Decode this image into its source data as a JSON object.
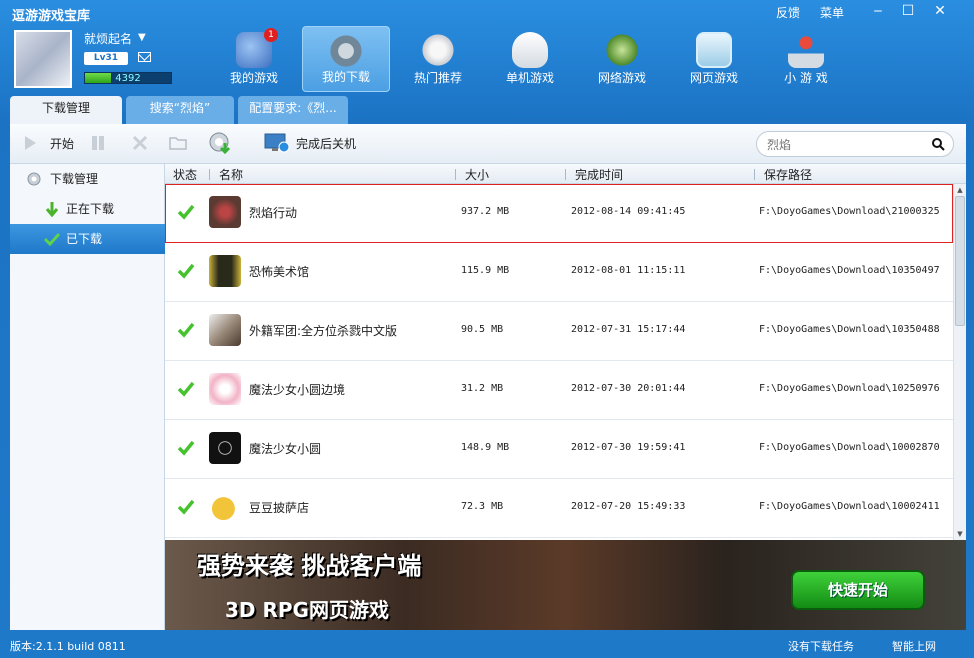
{
  "app": {
    "title": "逗游游戏宝库",
    "feedback": "反馈",
    "menu": "菜单",
    "minimize": "‒",
    "maximize": "☐",
    "close": "✕"
  },
  "user": {
    "name": "就烦起名",
    "level": "Lv31",
    "exp": "4392",
    "exp_fraction": 0.3
  },
  "nav": [
    {
      "label": "我的游戏",
      "badge": "1",
      "icon": "my-games-icon",
      "color": "#5f8fd6"
    },
    {
      "label": "我的下载",
      "icon": "download-gear-icon",
      "color": "#6f8799"
    },
    {
      "label": "热门推荐",
      "icon": "hot-recommend-icon",
      "color": "#d9a23c"
    },
    {
      "label": "单机游戏",
      "icon": "gamepad-icon",
      "color": "#e9eef4"
    },
    {
      "label": "网络游戏",
      "icon": "network-game-icon",
      "color": "#8bb34d"
    },
    {
      "label": "网页游戏",
      "icon": "web-game-icon",
      "color": "#a9d7ef"
    },
    {
      "label": "小 游 戏",
      "icon": "joystick-icon",
      "color": "#d63a2e"
    }
  ],
  "tabs": [
    {
      "label": "下载管理"
    },
    {
      "label": "搜索“烈焰”"
    },
    {
      "label": "配置要求:《烈..."
    }
  ],
  "toolbar": {
    "start": "开始",
    "shutdown_after": "完成后关机",
    "search_placeholder": "烈焰"
  },
  "sidebar": {
    "root": "下载管理",
    "downloading": "正在下载",
    "downloaded": "已下载"
  },
  "table": {
    "headers": {
      "status": "状态",
      "name": "名称",
      "size": "大小",
      "time": "完成时间",
      "path": "保存路径"
    },
    "rows": [
      {
        "name": "烈焰行动",
        "size": "937.2 MB",
        "time": "2012-08-14 09:41:45",
        "path": "F:\\DoyoGames\\Download\\21000325",
        "icon_color": "#5a3a32"
      },
      {
        "name": "恐怖美术馆",
        "size": "115.9 MB",
        "time": "2012-08-01 11:15:11",
        "path": "F:\\DoyoGames\\Download\\10350497",
        "icon_color": "#2a2a1a"
      },
      {
        "name": "外籍军团:全方位杀戮中文版",
        "size": "90.5 MB",
        "time": "2012-07-31 15:17:44",
        "path": "F:\\DoyoGames\\Download\\10350488",
        "icon_color": "#9a8a7a"
      },
      {
        "name": "魔法少女小圆边境",
        "size": "31.2 MB",
        "time": "2012-07-30 20:01:44",
        "path": "F:\\DoyoGames\\Download\\10250976",
        "icon_color": "#f2b3c7"
      },
      {
        "name": "魔法少女小圆",
        "size": "148.9 MB",
        "time": "2012-07-30 19:59:41",
        "path": "F:\\DoyoGames\\Download\\10002870",
        "icon_color": "#111111"
      },
      {
        "name": "豆豆披萨店",
        "size": "72.3 MB",
        "time": "2012-07-20 15:49:33",
        "path": "F:\\DoyoGames\\Download\\10002411",
        "icon_color": "#f2c43a"
      }
    ]
  },
  "banner": {
    "title": "强势来袭 挑战客户端",
    "subtitle": "3D RPG网页游戏",
    "button": "快速开始"
  },
  "status": {
    "version": "版本:2.1.1 build 0811",
    "tasks": "没有下载任务",
    "net": "智能上网"
  }
}
